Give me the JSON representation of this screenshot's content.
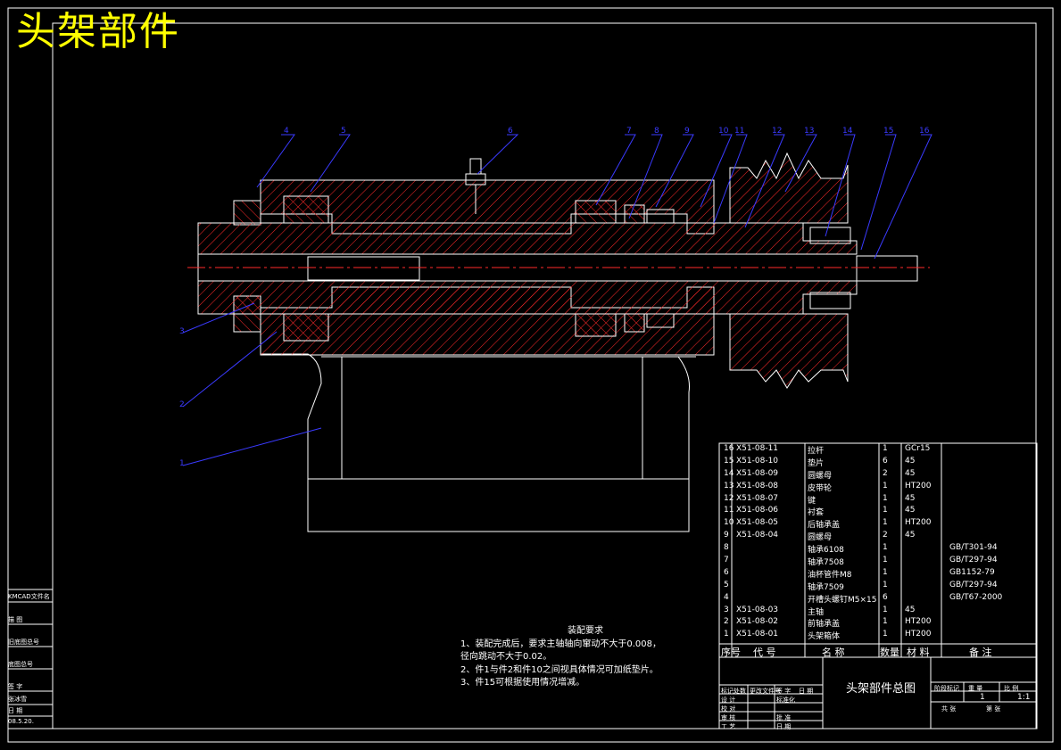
{
  "title": "头架部件",
  "callouts": [
    "1",
    "2",
    "3",
    "4",
    "5",
    "6",
    "7",
    "8",
    "9",
    "10",
    "11",
    "12",
    "13",
    "14",
    "15",
    "16"
  ],
  "notes": {
    "title": "装配要求",
    "lines": [
      "1、装配完成后，要求主轴轴向窜动不大于0.008，",
      "   径向跳动不大于0.02。",
      "2、件1与件2和件10之间视具体情况可加纸垫片。",
      "3、件15可根据使用情况增减。"
    ]
  },
  "bom": {
    "rows": [
      {
        "no": "16",
        "code": "X51-08-11",
        "name": "拉杆",
        "qty": "1",
        "mat": "GCr15",
        "note": ""
      },
      {
        "no": "15",
        "code": "X51-08-10",
        "name": "垫片",
        "qty": "6",
        "mat": "45",
        "note": ""
      },
      {
        "no": "14",
        "code": "X51-08-09",
        "name": "圆螺母",
        "qty": "2",
        "mat": "45",
        "note": ""
      },
      {
        "no": "13",
        "code": "X51-08-08",
        "name": "皮带轮",
        "qty": "1",
        "mat": "HT200",
        "note": ""
      },
      {
        "no": "12",
        "code": "X51-08-07",
        "name": "键",
        "qty": "1",
        "mat": "45",
        "note": ""
      },
      {
        "no": "11",
        "code": "X51-08-06",
        "name": "衬套",
        "qty": "1",
        "mat": "45",
        "note": ""
      },
      {
        "no": "10",
        "code": "X51-08-05",
        "name": "后轴承盖",
        "qty": "1",
        "mat": "HT200",
        "note": ""
      },
      {
        "no": "9",
        "code": "X51-08-04",
        "name": "圆螺母",
        "qty": "2",
        "mat": "45",
        "note": ""
      },
      {
        "no": "8",
        "code": "",
        "name": "轴承6108",
        "qty": "1",
        "mat": "",
        "note": "GB/T301-94"
      },
      {
        "no": "7",
        "code": "",
        "name": "轴承7508",
        "qty": "1",
        "mat": "",
        "note": "GB/T297-94"
      },
      {
        "no": "6",
        "code": "",
        "name": "油杯管件M8",
        "qty": "1",
        "mat": "",
        "note": "GB1152-79"
      },
      {
        "no": "5",
        "code": "",
        "name": "轴承7509",
        "qty": "1",
        "mat": "",
        "note": "GB/T297-94"
      },
      {
        "no": "4",
        "code": "",
        "name": "开槽头螺钉M5×15",
        "qty": "6",
        "mat": "",
        "note": "GB/T67-2000"
      },
      {
        "no": "3",
        "code": "X51-08-03",
        "name": "主轴",
        "qty": "1",
        "mat": "45",
        "note": ""
      },
      {
        "no": "2",
        "code": "X51-08-02",
        "name": "前轴承盖",
        "qty": "1",
        "mat": "HT200",
        "note": ""
      },
      {
        "no": "1",
        "code": "X51-08-01",
        "name": "头架箱体",
        "qty": "1",
        "mat": "HT200",
        "note": ""
      }
    ],
    "header": {
      "no": "序号",
      "code": "代 号",
      "name": "名 称",
      "qty": "数量",
      "mat": "材 料",
      "note": "备 注"
    }
  },
  "title_block": {
    "drawing_name": "头架部件总图",
    "scale": "1:1",
    "sheet": "1",
    "rows_left": [
      "设 计",
      "校 对",
      "审 核",
      "工 艺"
    ],
    "marks": [
      "标记",
      "处数",
      "更改文件号",
      "签 字",
      "日 期"
    ],
    "std": "标准化",
    "approve": [
      "批 准",
      "日 期"
    ],
    "stage": [
      "阶段标记",
      "重 量",
      "比 例"
    ],
    "sheet_row": [
      "共 张",
      "第 张"
    ]
  },
  "left_box": {
    "items": [
      "KMCAD文件名",
      "描 图",
      "旧底图总号",
      "底图总号",
      "签 字",
      "张冰雪",
      "日 期",
      "08.5.20."
    ]
  },
  "colors": {
    "line": "#ffffff",
    "hatch": "#ff2a2a",
    "center": "#ff2a2a",
    "leader": "#3a3aff",
    "title": "#ffff00",
    "bg": "#000000"
  }
}
